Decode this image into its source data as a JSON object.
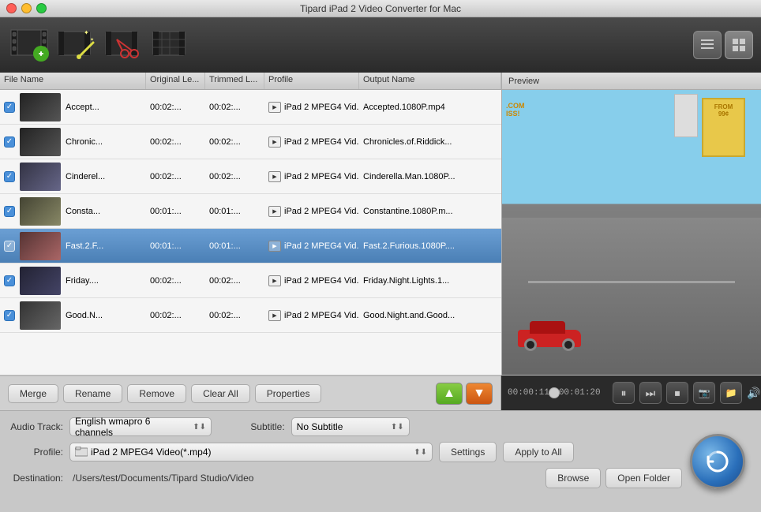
{
  "window": {
    "title": "Tipard iPad 2 Video Converter for Mac",
    "buttons": {
      "close": "close",
      "minimize": "minimize",
      "maximize": "maximize"
    }
  },
  "toolbar": {
    "icons": [
      "add-video-icon",
      "edit-video-icon",
      "clip-video-icon",
      "effect-icon"
    ],
    "view_list_label": "☰",
    "view_grid_label": "⊞"
  },
  "file_list": {
    "headers": [
      "File Name",
      "Original Le...",
      "Trimmed L...",
      "Profile",
      "Output Name"
    ],
    "rows": [
      {
        "checked": true,
        "name": "Accept...",
        "original_length": "00:02:...",
        "trimmed_length": "00:02:...",
        "profile": "iPad 2 MPEG4 Vid...",
        "output": "Accepted.1080P.mp4",
        "thumb": "action",
        "selected": false
      },
      {
        "checked": true,
        "name": "Chronic...",
        "original_length": "00:02:...",
        "trimmed_length": "00:02:...",
        "profile": "iPad 2 MPEG4 Vid...",
        "output": "Chronicles.of.Riddick...",
        "thumb": "action",
        "selected": false
      },
      {
        "checked": true,
        "name": "Cinderel...",
        "original_length": "00:02:...",
        "trimmed_length": "00:02:...",
        "profile": "iPad 2 MPEG4 Vid...",
        "output": "Cinderella.Man.1080P...",
        "thumb": "fantasy",
        "selected": false
      },
      {
        "checked": true,
        "name": "Consta...",
        "original_length": "00:01:...",
        "trimmed_length": "00:01:...",
        "profile": "iPad 2 MPEG4 Vid...",
        "output": "Constantine.1080P.m...",
        "thumb": "drama",
        "selected": false
      },
      {
        "checked": true,
        "name": "Fast.2.F...",
        "original_length": "00:01:...",
        "trimmed_length": "00:01:...",
        "profile": "iPad 2 MPEG4 Vid...",
        "output": "Fast.2.Furious.1080P....",
        "thumb": "fast",
        "selected": true
      },
      {
        "checked": true,
        "name": "Friday....",
        "original_length": "00:02:...",
        "trimmed_length": "00:02:...",
        "profile": "iPad 2 MPEG4 Vid...",
        "output": "Friday.Night.Lights.1...",
        "thumb": "night",
        "selected": false
      },
      {
        "checked": true,
        "name": "Good.N...",
        "original_length": "00:02:...",
        "trimmed_length": "00:02:...",
        "profile": "iPad 2 MPEG4 Vid...",
        "output": "Good.Night.and.Good...",
        "thumb": "good",
        "selected": false
      }
    ]
  },
  "controls": {
    "merge": "Merge",
    "rename": "Rename",
    "remove": "Remove",
    "clear_all": "Clear All",
    "properties": "Properties"
  },
  "preview": {
    "header": "Preview",
    "time_current": "00:00:11",
    "time_total": "00:01:20",
    "progress_percent": 15
  },
  "settings": {
    "audio_track_label": "Audio Track:",
    "audio_track_value": "English wmapro 6 channels",
    "subtitle_label": "Subtitle:",
    "subtitle_value": "No Subtitle",
    "profile_label": "Profile:",
    "profile_value": "iPad 2 MPEG4 Video(*.mp4)",
    "destination_label": "Destination:",
    "destination_path": "/Users/test/Documents/Tipard Studio/Video",
    "settings_btn": "Settings",
    "apply_to_all_btn": "Apply to All",
    "browse_btn": "Browse",
    "open_folder_btn": "Open Folder"
  }
}
